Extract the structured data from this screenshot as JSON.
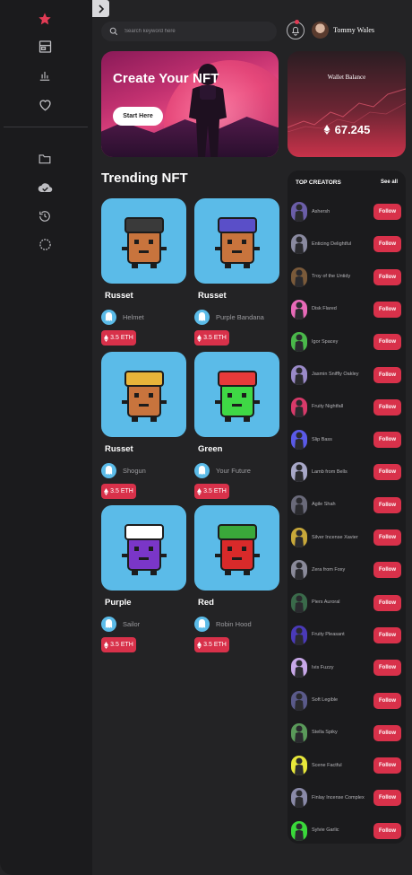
{
  "header": {
    "search_placeholder": "Search keyword here",
    "user_name": "Tommy Wales"
  },
  "banner": {
    "title": "Create Your NFT",
    "button_label": "Start Here"
  },
  "wallet": {
    "title": "Wallet Balance",
    "value": "67.245"
  },
  "trending": {
    "title": "Trending NFT",
    "cards": [
      {
        "name": "Russet",
        "owner": "Helmet",
        "price": "3.5 ETH",
        "body": "#c8743d",
        "hat": "#3a3a3a"
      },
      {
        "name": "Russet",
        "owner": "Purple Bandana",
        "price": "3.5 ETH",
        "body": "#c8743d",
        "hat": "#5a4fc8"
      },
      {
        "name": "Russet",
        "owner": "Shogun",
        "price": "3.5 ETH",
        "body": "#c8743d",
        "hat": "#e8b43a"
      },
      {
        "name": "Green",
        "owner": "Your Future",
        "price": "3.5 ETH",
        "body": "#3fd845",
        "hat": "#e83a3a"
      },
      {
        "name": "Purple",
        "owner": "Sailor",
        "price": "3.5 ETH",
        "body": "#7a36c8",
        "hat": "#ffffff"
      },
      {
        "name": "Red",
        "owner": "Robin Hood",
        "price": "3.5 ETH",
        "body": "#d82a2a",
        "hat": "#3aa83a"
      }
    ]
  },
  "creators": {
    "title": "TOP CREATORS",
    "see_all": "See all",
    "follow_label": "Follow",
    "items": [
      {
        "name": "Ashersh",
        "color": "#6b5ea8"
      },
      {
        "name": "Enticing Delightful",
        "color": "#8a8aa0"
      },
      {
        "name": "Troy of the Untidy",
        "color": "#7a5a3a"
      },
      {
        "name": "Disk Flared",
        "color": "#e86ab8"
      },
      {
        "name": "Igor Spacey",
        "color": "#4ab84a"
      },
      {
        "name": "Jasmin Sniffly Oakley",
        "color": "#9a8ac8"
      },
      {
        "name": "Fruity Nightfall",
        "color": "#d83a6a"
      },
      {
        "name": "Slip Bass",
        "color": "#5a5ae8"
      },
      {
        "name": "Lamb from Bells",
        "color": "#a8a8c8"
      },
      {
        "name": "Agile Shah",
        "color": "#6a6a7a"
      },
      {
        "name": "Silver Incense Xavier",
        "color": "#c8a83a"
      },
      {
        "name": "Zera from Foxy",
        "color": "#8a8a9a"
      },
      {
        "name": "Piers Auroral",
        "color": "#3a6a4a"
      },
      {
        "name": "Fruity Pleasant",
        "color": "#4a3ab8"
      },
      {
        "name": "Ivis Fuzzy",
        "color": "#c8a8e8"
      },
      {
        "name": "Soft Legible",
        "color": "#5a5a8a"
      },
      {
        "name": "Stella Spiky",
        "color": "#5a9a5a"
      },
      {
        "name": "Scene Factful",
        "color": "#e8e83a"
      },
      {
        "name": "Finlay Incense Complex",
        "color": "#8a8aa8"
      },
      {
        "name": "Sylvie Garlic",
        "color": "#3ad83a"
      }
    ]
  }
}
